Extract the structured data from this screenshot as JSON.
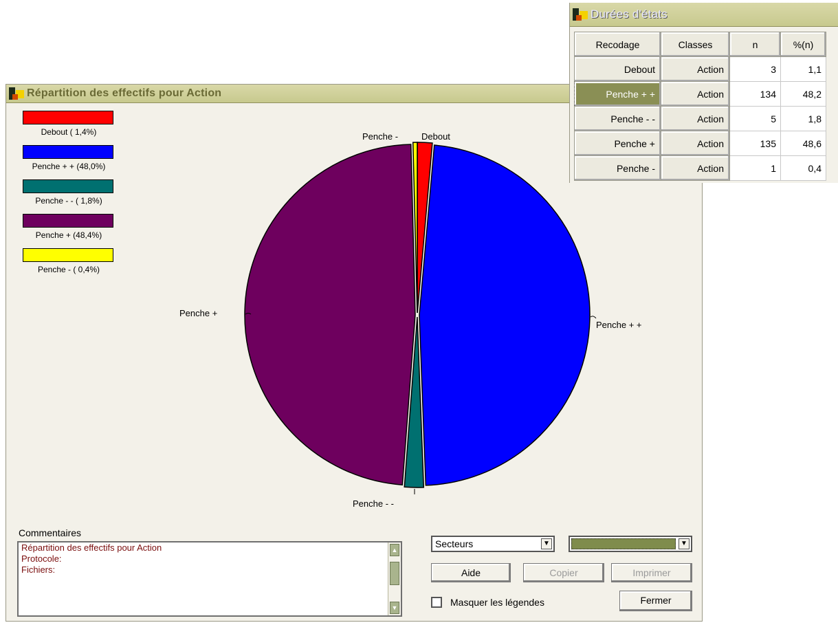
{
  "main_window": {
    "title": "Répartition des effectifs pour Action"
  },
  "legend": [
    {
      "label": "Debout ( 1,4%)",
      "color": "#ff0000"
    },
    {
      "label": "Penche + + (48,0%)",
      "color": "#0000ff"
    },
    {
      "label": "Penche - - ( 1,8%)",
      "color": "#007070"
    },
    {
      "label": "Penche + (48,4%)",
      "color": "#6e005e"
    },
    {
      "label": "Penche - ( 0,4%)",
      "color": "#ffff00"
    }
  ],
  "chart_data": {
    "type": "pie",
    "slices": [
      {
        "name": "Debout",
        "value": 1.4,
        "color": "#ff0000"
      },
      {
        "name": "Penche + +",
        "value": 48.0,
        "color": "#0000ff"
      },
      {
        "name": "Penche - -",
        "value": 1.8,
        "color": "#007070"
      },
      {
        "name": "Penche +",
        "value": 48.4,
        "color": "#6e005e"
      },
      {
        "name": "Penche -",
        "value": 0.4,
        "color": "#ffff00"
      }
    ]
  },
  "pie_labels": {
    "debout": "Debout",
    "penche_pp": "Penche + +",
    "penche_mm": "Penche - -",
    "penche_p": "Penche +",
    "penche_m": "Penche -"
  },
  "comments": {
    "label": "Commentaires",
    "lines": [
      "Répartition des effectifs pour Action",
      "Protocole:",
      "Fichiers:"
    ]
  },
  "controls": {
    "chart_type_select": "Secteurs",
    "aide_button": "Aide",
    "copier_button": "Copier",
    "imprimer_button": "Imprimer",
    "fermer_button": "Fermer",
    "masquer_checkbox_label": "Masquer les légendes"
  },
  "table_window": {
    "title": "Durées d'états",
    "headers": [
      "Recodage",
      "Classes",
      "n",
      "%(n)"
    ],
    "rows": [
      [
        "Debout",
        "Action",
        "3",
        "1,1"
      ],
      [
        "Penche + +",
        "Action",
        "134",
        "48,2"
      ],
      [
        "Penche - -",
        "Action",
        "5",
        "1,8"
      ],
      [
        "Penche +",
        "Action",
        "135",
        "48,6"
      ],
      [
        "Penche -",
        "Action",
        "1",
        "0,4"
      ]
    ]
  }
}
